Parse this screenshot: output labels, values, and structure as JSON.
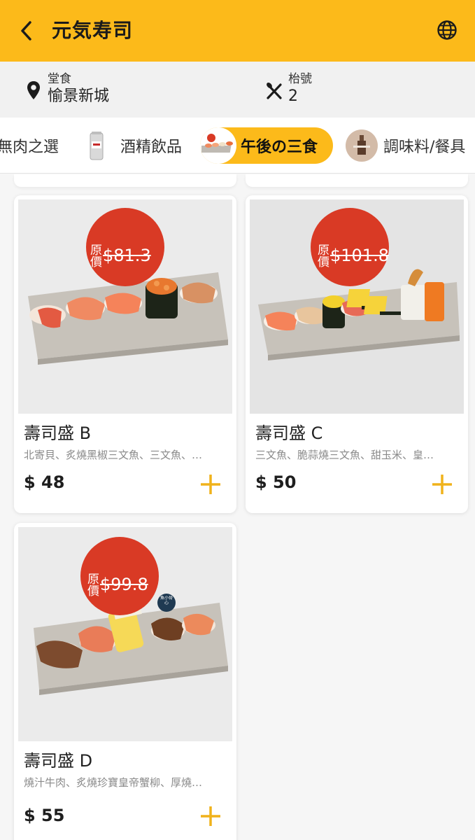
{
  "header": {
    "title": "元気寿司",
    "back_icon": "chevron-left-icon",
    "language_icon": "globe-icon"
  },
  "info": {
    "dine_mode_label": "堂食",
    "store_name": "愉景新城",
    "table_label": "枱號",
    "table_number": "2"
  },
  "categories": [
    {
      "label": "無肉之選",
      "active": false
    },
    {
      "label": "酒精飲品",
      "active": false
    },
    {
      "label": "午後の三食",
      "active": true
    },
    {
      "label": "調味料/餐具",
      "active": false
    }
  ],
  "products": [
    {
      "name": "壽司盛 B",
      "description": "北寄貝、炙燒黑椒三文魚、三文魚、…",
      "price": "$ 48",
      "original_price_label": "原價",
      "original_price": "$81.3"
    },
    {
      "name": "壽司盛 C",
      "description": "三文魚、脆蒜燒三文魚、甜玉米、皇…",
      "price": "$ 50",
      "original_price_label": "原價",
      "original_price": "$101.8"
    },
    {
      "name": "壽司盛 D",
      "description": "燒汁牛肉、炙燒珍寶皇帝蟹柳、厚燒…",
      "price": "$ 55",
      "original_price_label": "原價",
      "original_price": "$99.8",
      "bone_note": "魚小骨心"
    }
  ],
  "colors": {
    "accent": "#fcba1a",
    "badge_red": "#d93a25",
    "add_icon": "#f0b21b"
  }
}
